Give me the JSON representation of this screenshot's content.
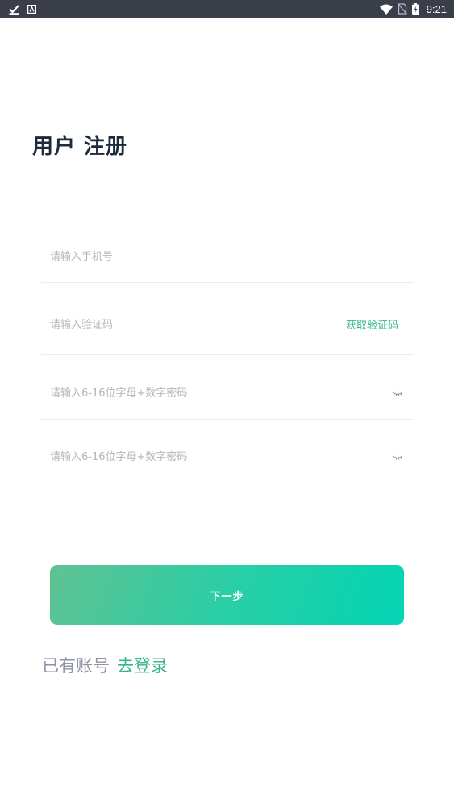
{
  "status_bar": {
    "time": "9:21",
    "icons": [
      "check-icon",
      "a-icon",
      "wifi-icon",
      "no-sim-icon",
      "battery-icon"
    ]
  },
  "title": "用户 注册",
  "form": {
    "phone_placeholder": "请输入手机号",
    "code_placeholder": "请输入验证码",
    "get_code_label": "获取验证码",
    "password_placeholder": "请输入6-16位字母+数字密码",
    "confirm_password_placeholder": "请输入6-16位字母+数字密码"
  },
  "next_button_label": "下一步",
  "login_prompt": "已有账号",
  "login_link": "去登录",
  "colors": {
    "accent": "#36b38f",
    "button_gradient_start": "#5fc293",
    "button_gradient_end": "#03d5b3",
    "title": "#1d2a3b",
    "status_bar": "#3a3e49"
  }
}
